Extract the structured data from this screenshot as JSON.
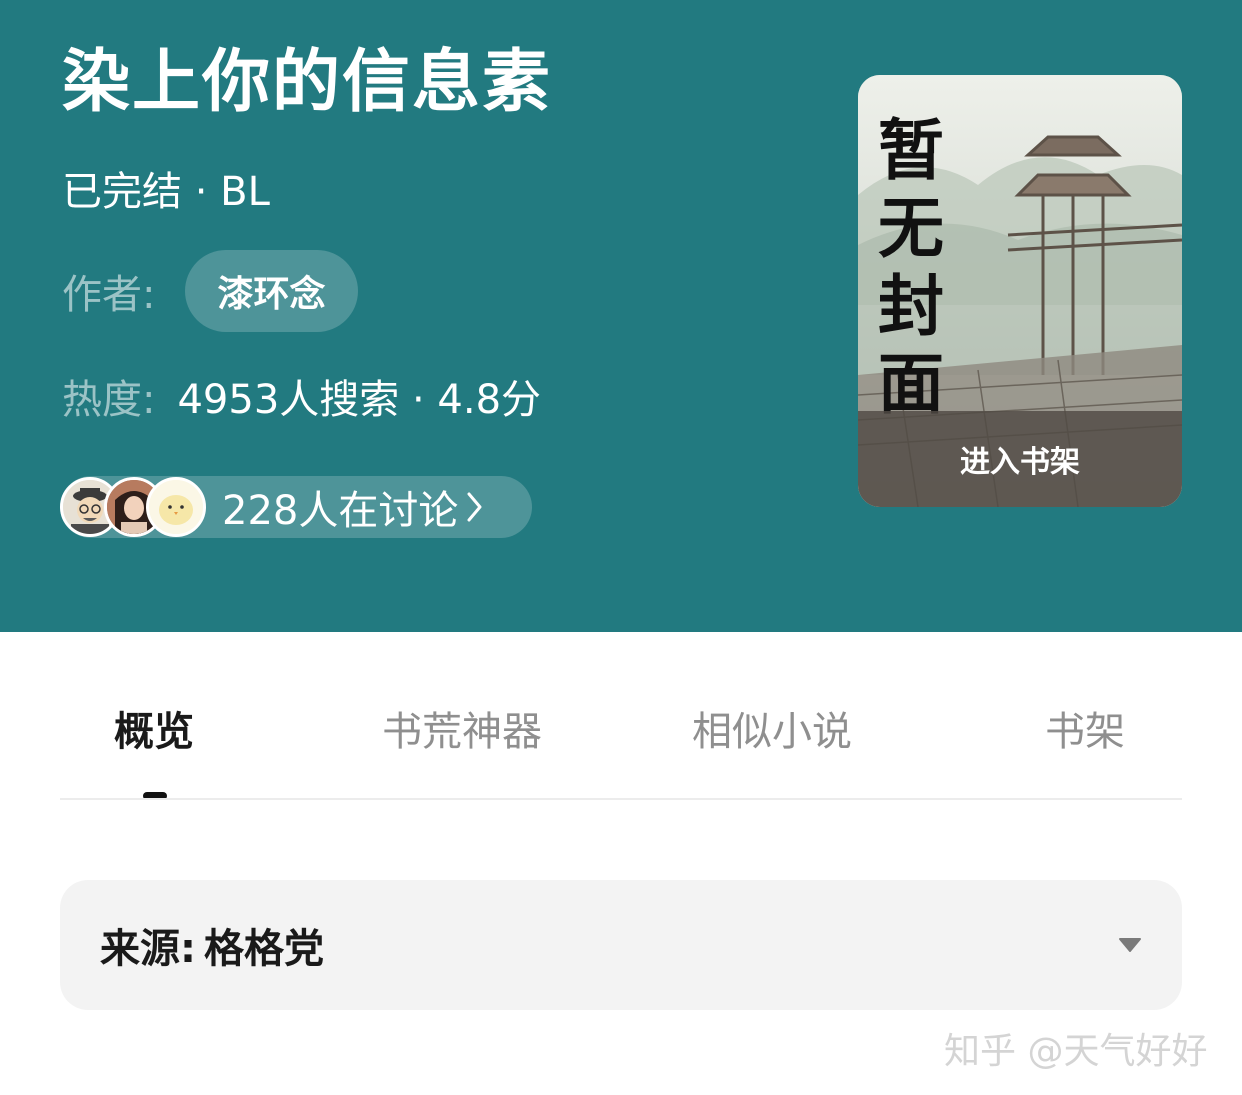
{
  "book": {
    "title": "染上你的信息素",
    "meta": "已完结 · BL",
    "author_label": "作者:",
    "author_name": "漆环念",
    "heat_label": "热度:",
    "heat_value": "4953人搜索 · 4.8分",
    "discussion_text": "228人在讨论",
    "cover_text": "暂无封面",
    "cover_button": "进入书架"
  },
  "tabs": [
    {
      "label": "概览",
      "active": true
    },
    {
      "label": "书荒神器",
      "active": false
    },
    {
      "label": "相似小说",
      "active": false
    },
    {
      "label": "书架",
      "active": false
    }
  ],
  "source": {
    "label": "来源:",
    "value": "格格党"
  },
  "watermark": "知乎 @天气好好",
  "colors": {
    "header_bg": "#227a80",
    "active_tab": "#1a1a1a",
    "inactive_tab": "#8f8f8f",
    "source_bg": "#f3f3f3"
  },
  "icons": {
    "discussion_arrow": "chevron-right-icon",
    "source_dropdown": "caret-down-icon"
  }
}
